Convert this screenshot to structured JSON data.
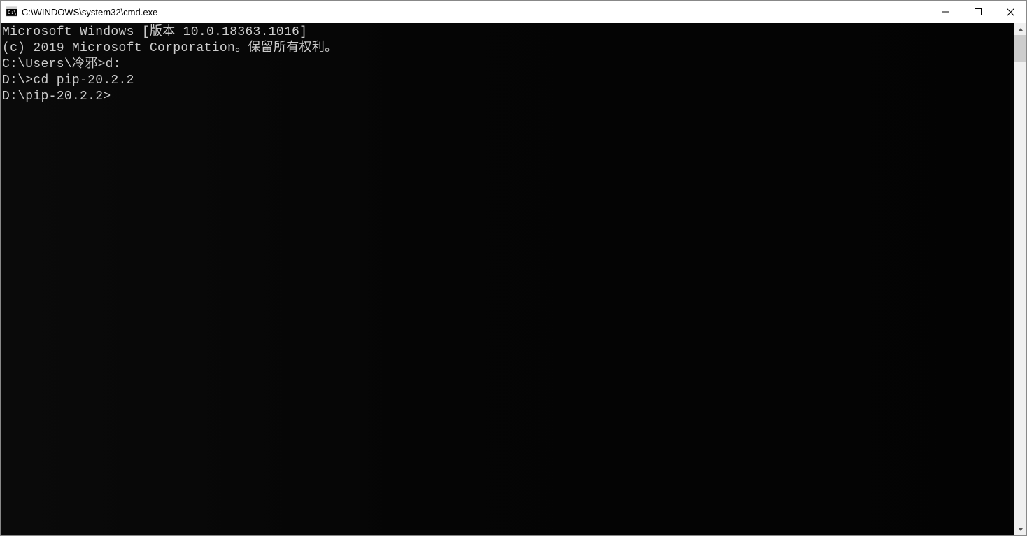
{
  "window": {
    "title": "C:\\WINDOWS\\system32\\cmd.exe"
  },
  "terminal": {
    "lines": [
      "Microsoft Windows [版本 10.0.18363.1016]",
      "(c) 2019 Microsoft Corporation。保留所有权利。",
      "",
      "C:\\Users\\冷邪>d:",
      "",
      "D:\\>cd pip-20.2.2",
      "",
      "D:\\pip-20.2.2>"
    ]
  }
}
